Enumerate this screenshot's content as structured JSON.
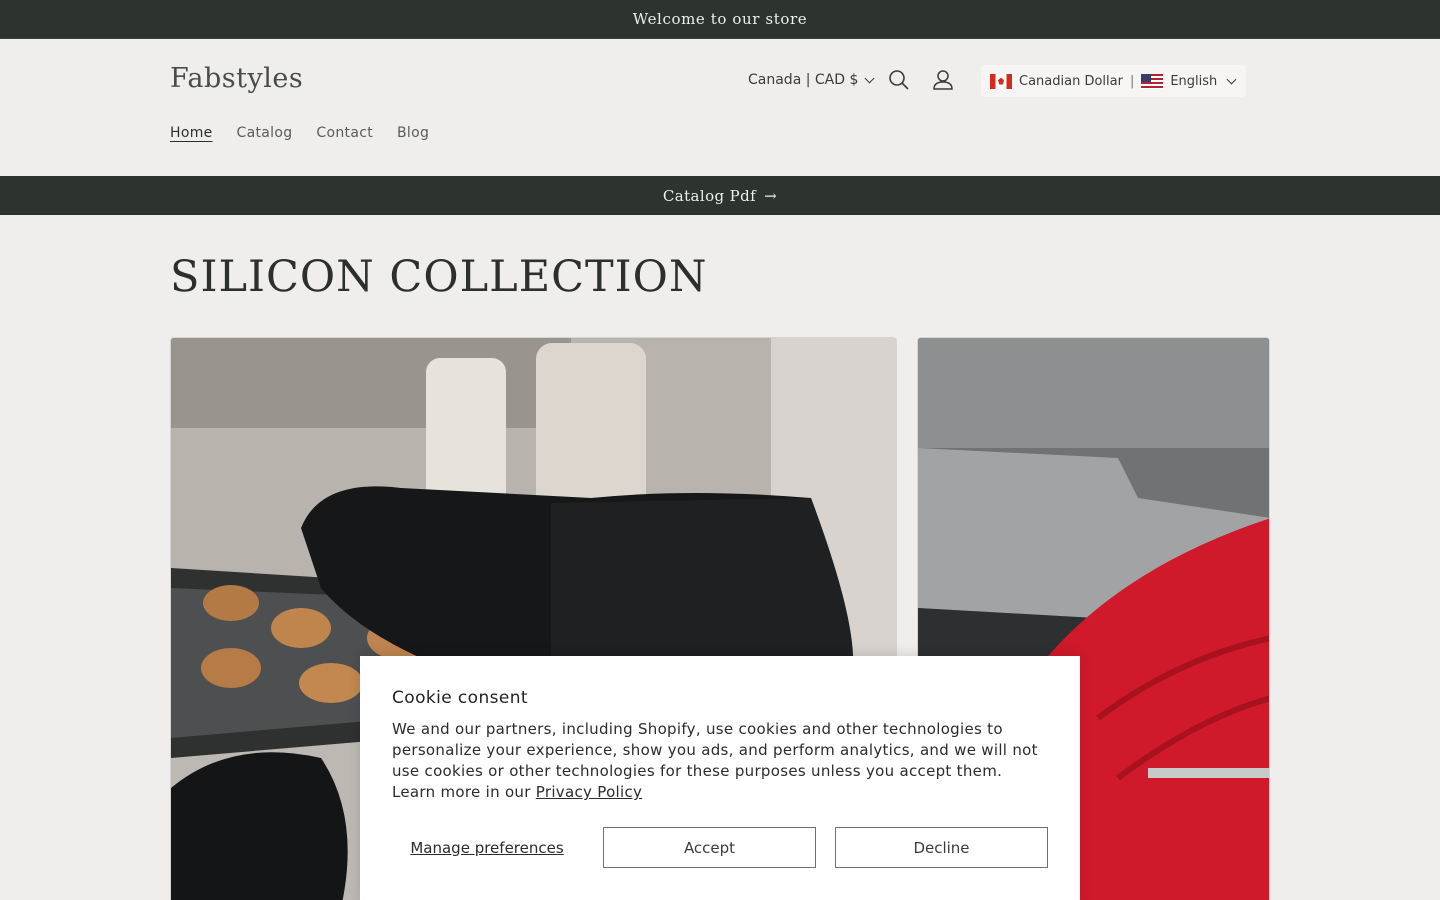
{
  "announcement": "Welcome to our store",
  "header": {
    "logo": "Fabstyles",
    "nav": [
      "Home",
      "Catalog",
      "Contact",
      "Blog"
    ],
    "country_selector": "Canada | CAD $",
    "currency_widget": {
      "currency": "Canadian Dollar",
      "separator": "|",
      "language": "English"
    }
  },
  "catalog_bar": {
    "label": "Catalog Pdf",
    "arrow": "→"
  },
  "collection": {
    "title": "SILICON COLLECTION"
  },
  "products": [
    {
      "image": "black silicone oven mitt holding cookie tray"
    },
    {
      "image": "red silicone oven mitt at grill"
    }
  ],
  "cookie_banner": {
    "title": "Cookie consent",
    "body": "We and our partners, including Shopify, use cookies and other technologies to personalize your experience, show you ads, and perform analytics, and we will not use cookies or other technologies for these purposes unless you accept them. Learn more in our ",
    "policy_link": "Privacy Policy",
    "manage": "Manage preferences",
    "accept": "Accept",
    "decline": "Decline"
  },
  "colors": {
    "background": "#efeeec",
    "dark_bar": "#2d332f",
    "text": "#2d2f2d"
  }
}
